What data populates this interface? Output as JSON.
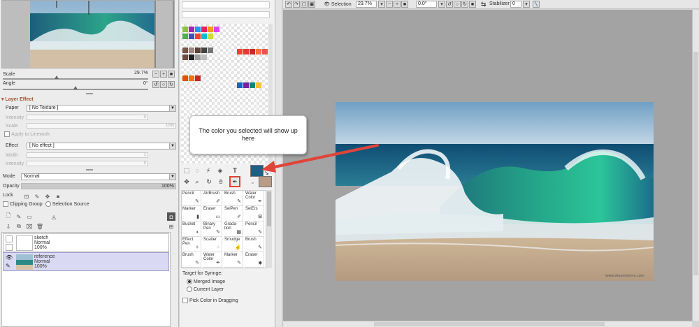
{
  "navigator": {
    "scale_label": "Scale",
    "scale_value": "29.7%",
    "angle_label": "Angle",
    "angle_value": "0°"
  },
  "layer_effect": {
    "header": "Layer Effect",
    "paper_label": "Paper",
    "paper_value": "[ No Texture ]",
    "intensity_label": "Intensity",
    "intensity_value": "0",
    "scale_label": "Scale",
    "scale_value": "10%",
    "apply_linework": "Apply to Linework",
    "effect_label": "Effect",
    "effect_value": "[ No effect ]",
    "width_label": "Width",
    "width_value": "1",
    "intensity2_label": "Intensity",
    "intensity2_value": "0"
  },
  "layer": {
    "mode_label": "Mode",
    "mode_value": "Normal",
    "opacity_label": "Opacity",
    "opacity_value": "100%",
    "opacity_fraction": 1.0,
    "lock_label": "Lock",
    "clipping_group": "Clipping Group",
    "selection_source": "Selection Source"
  },
  "layers": [
    {
      "name": "sketch",
      "mode": "Normal",
      "opacity": "100%",
      "selected": false
    },
    {
      "name": "reference",
      "mode": "Normal",
      "opacity": "100%",
      "selected": true
    }
  ],
  "tools": [
    [
      "Pencil",
      "AirBrush",
      "Brush",
      "Water Color"
    ],
    [
      "Marker",
      "Eraser",
      "SelPen",
      "SelErs"
    ],
    [
      "Bucket",
      "Binary Pen",
      "Grada-tion",
      "Pencil"
    ],
    [
      "Effect Pen",
      "Scatter",
      "Smudge",
      "Brush"
    ],
    [
      "Brush",
      "Water Color",
      "Marker",
      "Eraser"
    ]
  ],
  "syringe": {
    "title": "Target for Syringe:",
    "merged": "Merged Image",
    "current": "Current Layer",
    "pick_dragging": "Pick Color in Dragging"
  },
  "toolbar": {
    "selection_label": "Selection",
    "zoom_value": "29.7%",
    "angle_value": "0.0°",
    "stabilizer_label": "Stabilizer",
    "stabilizer_value": "0"
  },
  "callout": {
    "text": "The color you selected will show up here"
  },
  "canvas_image": {
    "watermark": "www.dreamstime.com"
  },
  "colors": {
    "main_color": "#1d5f86",
    "sub_color": "#b89c86",
    "highlight": "#e0443a"
  },
  "swatches": [
    {
      "c": "#8bc34a"
    },
    {
      "c": "#9c27b0"
    },
    {
      "c": "#2196f3"
    },
    {
      "c": "#e91e63"
    },
    {
      "c": "#ff9800"
    },
    {
      "c": "#e040fb"
    },
    {
      "c": "#4caf50"
    },
    {
      "c": "#3f51b5"
    },
    {
      "c": "#f44336"
    },
    {
      "c": "#00bcd4"
    },
    {
      "c": "#cddc39"
    },
    {
      "c": "#795548"
    },
    {
      "c": "#a1887f"
    },
    {
      "c": "#5d4037"
    },
    {
      "c": "#424242"
    },
    {
      "c": "#757575"
    },
    {
      "c": "#6d4c41"
    },
    {
      "c": "#212121"
    },
    {
      "c": "#9e9e9e"
    },
    {
      "c": "#bdbdbd"
    },
    {
      "c": "#e65100"
    },
    {
      "c": "#ff6f00"
    },
    {
      "c": "#c62828"
    }
  ]
}
